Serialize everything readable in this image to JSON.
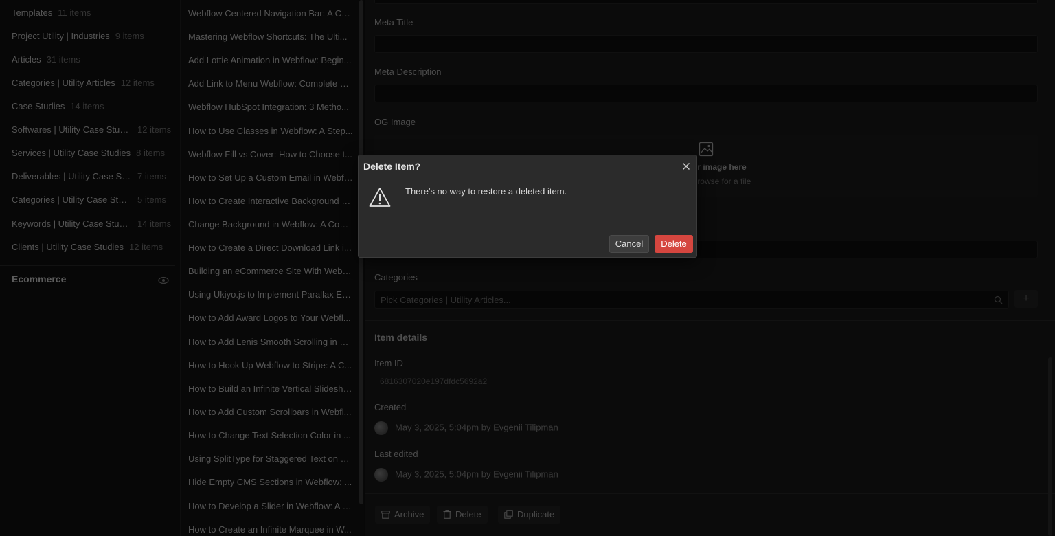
{
  "collections": [
    {
      "name": "Templates",
      "count": "11 items"
    },
    {
      "name": "Project Utility | Industries",
      "count": "9 items"
    },
    {
      "name": "Articles",
      "count": "31 items"
    },
    {
      "name": "Categories | Utility Articles",
      "count": "12 items"
    },
    {
      "name": "Case Studies",
      "count": "14 items"
    },
    {
      "name": "Softwares | Utility Case Studies",
      "count": "12 items"
    },
    {
      "name": "Services | Utility Case Studies",
      "count": "8 items"
    },
    {
      "name": "Deliverables | Utility Case Studies",
      "count": "7 items"
    },
    {
      "name": "Categories | Utility Case Studies",
      "count": "5 items"
    },
    {
      "name": "Keywords | Utility Case Studies",
      "count": "14 items"
    },
    {
      "name": "Clients | Utility Case Studies",
      "count": "12 items"
    }
  ],
  "ecommerce": {
    "title": "Ecommerce"
  },
  "items": [
    "Webflow Centered Navigation Bar: A Co...",
    "Mastering Webflow Shortcuts: The Ulti...",
    "Add Lottie Animation in Webflow: Begin...",
    "Add Link to Menu Webflow: Complete G...",
    "Webflow HubSpot Integration: 3 Metho...",
    "How to Use Classes in Webflow: A Step...",
    "Webflow Fill vs Cover: How to Choose t...",
    "How to Set Up a Custom Email in Webfl...",
    "How to Create Interactive Background E...",
    "Change Background in Webflow: A Com...",
    "How to Create a Direct Download Link i...",
    "Building an eCommerce Site With Webfl...",
    "Using Ukiyo.js to Implement Parallax Eff...",
    "How to Add Award Logos to Your Webfl...",
    "How to Add Lenis Smooth Scrolling in W...",
    "How to Hook Up Webflow to Stripe: A C...",
    "How to Build an Infinite Vertical Slidesho...",
    "How to Add Custom Scrollbars in Webfl...",
    "How to Change Text Selection Color in ...",
    "Using SplitType for Staggered Text on S...",
    "Hide Empty CMS Sections in Webflow: ...",
    "How to Develop a Slider in Webflow: A C...",
    "How to Create an Infinite Marquee in W..."
  ],
  "editor": {
    "meta_title_label": "Meta Title",
    "meta_description_label": "Meta Description",
    "og_image_label": "OG Image",
    "og_drop_text": "r image here",
    "og_browse_text": "browse for a file",
    "categories_label": "Categories",
    "categories_placeholder": "Pick Categories | Utility Articles...",
    "add_symbol": "+",
    "details_title": "Item details",
    "item_id_label": "Item ID",
    "item_id_value": "6816307020e197dfdc5692a2",
    "created_label": "Created",
    "created_value": "May 3, 2025, 5:04pm by Evgenii Tilipman",
    "last_edited_label": "Last edited",
    "last_edited_value": "May 3, 2025, 5:04pm by Evgenii Tilipman",
    "archive_label": "Archive",
    "delete_label": "Delete",
    "duplicate_label": "Duplicate"
  },
  "modal": {
    "title": "Delete Item?",
    "message": "There's no way to restore a deleted item.",
    "cancel_label": "Cancel",
    "delete_label": "Delete"
  },
  "colors": {
    "danger": "#d5463f",
    "background": "#0e0e0e",
    "modal_bg": "#2b2b2b"
  }
}
